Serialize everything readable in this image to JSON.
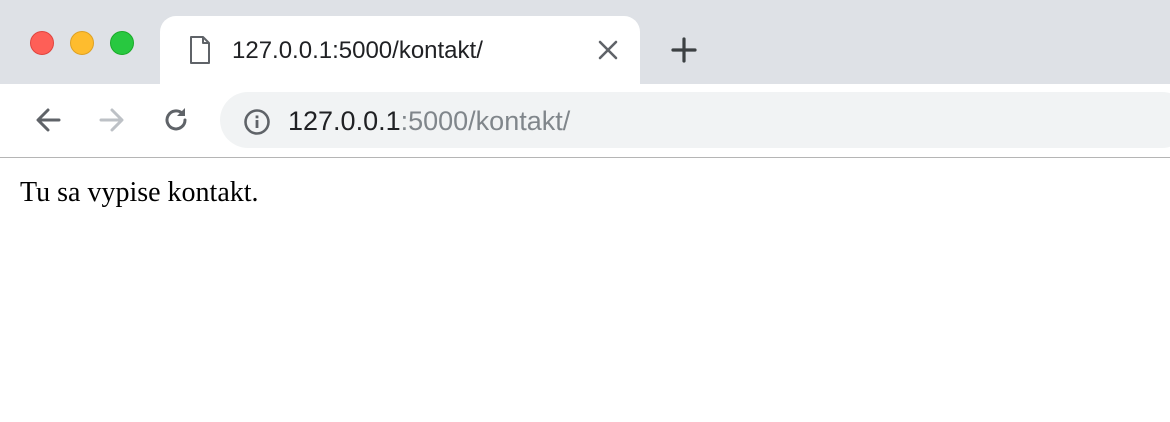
{
  "window": {
    "controls": [
      "close",
      "minimize",
      "maximize"
    ],
    "colors": {
      "close": "#fe5f57",
      "minimize": "#febc2e",
      "maximize": "#28c840"
    }
  },
  "tab": {
    "title": "127.0.0.1:5000/kontakt/",
    "icon": "document-icon"
  },
  "toolbar": {
    "back_icon": "arrow-left-icon",
    "forward_icon": "arrow-right-icon",
    "reload_icon": "reload-icon",
    "url_host": "127.0.0.1",
    "url_rest": ":5000/kontakt/",
    "info_icon": "info-icon"
  },
  "page": {
    "text": "Tu sa vypise kontakt."
  }
}
